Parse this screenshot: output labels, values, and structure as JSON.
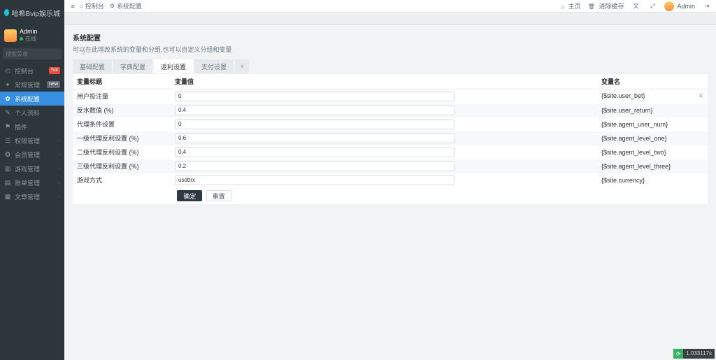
{
  "brand": {
    "name": "哈希Bvip娱乐城"
  },
  "user": {
    "name": "Admin",
    "state": "在线"
  },
  "search": {
    "placeholder": "搜索菜单"
  },
  "nav": [
    {
      "icon": "◴",
      "label": "控制台",
      "name": "dashboard",
      "badge": "hot",
      "badgeCls": "badge-red"
    },
    {
      "icon": "✦",
      "label": "常规管理",
      "name": "general",
      "badge": "new",
      "badgeCls": "badge-gray"
    },
    {
      "icon": "✿",
      "label": "系统配置",
      "name": "sysconfig",
      "active": true
    },
    {
      "icon": "✎",
      "label": "个人资料",
      "name": "profile"
    },
    {
      "icon": "⚑",
      "label": "插件",
      "name": "plugins"
    },
    {
      "icon": "☰",
      "label": "权限管理",
      "name": "permissions",
      "caret": true
    },
    {
      "icon": "✪",
      "label": "会员管理",
      "name": "members",
      "caret": true
    },
    {
      "icon": "▥",
      "label": "游戏管理",
      "name": "games",
      "caret": true
    },
    {
      "icon": "▤",
      "label": "账单管理",
      "name": "bills",
      "caret": true
    },
    {
      "icon": "▦",
      "label": "文章管理",
      "name": "articles",
      "caret": true
    }
  ],
  "breadcrumb": {
    "home": "控制台",
    "current": "系统配置"
  },
  "header": {
    "home": "主页",
    "clear": "清除缓存",
    "admin": "Admin"
  },
  "page": {
    "title": "系统配置",
    "subtitle": "可以在此增改系统的变量和分组,也可以自定义分组和变量"
  },
  "tabs": [
    "基础配置",
    "字典配置",
    "返利设置",
    "支付设置"
  ],
  "activeTab": 2,
  "table": {
    "head": {
      "c1": "变量标题",
      "c2": "变量值",
      "c3": "变量名"
    },
    "rows": [
      {
        "title": "用户投注量",
        "value": "0",
        "name": "{$site.user_bet}",
        "del": true
      },
      {
        "title": "反水数值 (%)",
        "value": "0.4",
        "name": "{$site.user_return}"
      },
      {
        "title": "代理条件设置",
        "value": "0",
        "name": "{$site.agent_user_num}"
      },
      {
        "title": "一级代理反利设置 (%)",
        "value": "0.6",
        "name": "{$site.agent_level_one}"
      },
      {
        "title": "二级代理反利设置 (%)",
        "value": "0.4",
        "name": "{$site.agent_level_two}"
      },
      {
        "title": "三级代理反利设置 (%)",
        "value": "0.2",
        "name": "{$site.agent_level_three}"
      },
      {
        "title": "游戏方式",
        "value": "usdttrx",
        "name": "{$site.currency}"
      }
    ]
  },
  "buttons": {
    "ok": "确定",
    "reset": "重置"
  },
  "perf": "1.033117s"
}
